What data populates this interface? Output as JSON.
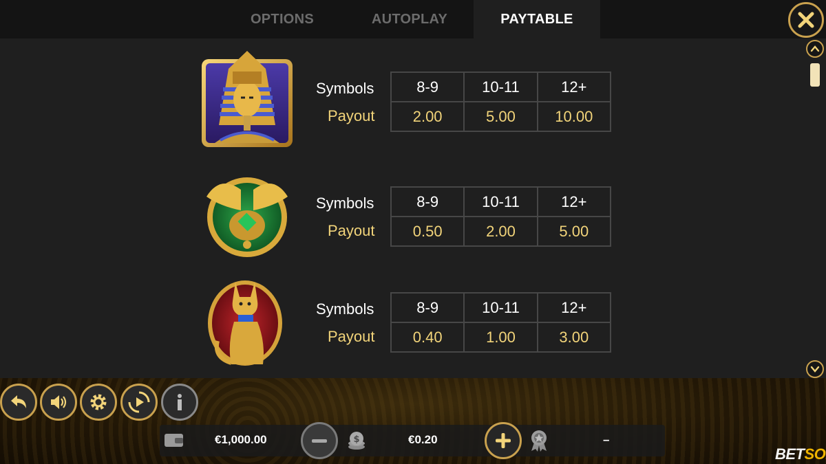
{
  "tabs": [
    {
      "label": "OPTIONS",
      "active": false
    },
    {
      "label": "AUTOPLAY",
      "active": false
    },
    {
      "label": "PAYTABLE",
      "active": true
    }
  ],
  "paytable": {
    "rows": [
      {
        "symbol": "pharaoh-symbol",
        "symbols_label": "Symbols",
        "payout_label": "Payout",
        "counts": [
          "8-9",
          "10-11",
          "12+"
        ],
        "payouts": [
          "2.00",
          "5.00",
          "10.00"
        ]
      },
      {
        "symbol": "scarab-symbol",
        "symbols_label": "Symbols",
        "payout_label": "Payout",
        "counts": [
          "8-9",
          "10-11",
          "12+"
        ],
        "payouts": [
          "0.50",
          "2.00",
          "5.00"
        ]
      },
      {
        "symbol": "cat-symbol",
        "symbols_label": "Symbols",
        "payout_label": "Payout",
        "counts": [
          "8-9",
          "10-11",
          "12+"
        ],
        "payouts": [
          "0.40",
          "1.00",
          "3.00"
        ]
      }
    ]
  },
  "controls": {
    "icons": [
      "back-icon",
      "sound-icon",
      "settings-icon",
      "autoplay-icon",
      "info-icon"
    ],
    "balance": "€1,000.00",
    "bet": "€0.20",
    "win": "–"
  },
  "brand": {
    "part1": "BET",
    "part2": "SOFT"
  },
  "colors": {
    "gold": "#c9a14e",
    "payout_text": "#f2d47a",
    "background": "#1f1f1f",
    "table_border": "#474747"
  }
}
